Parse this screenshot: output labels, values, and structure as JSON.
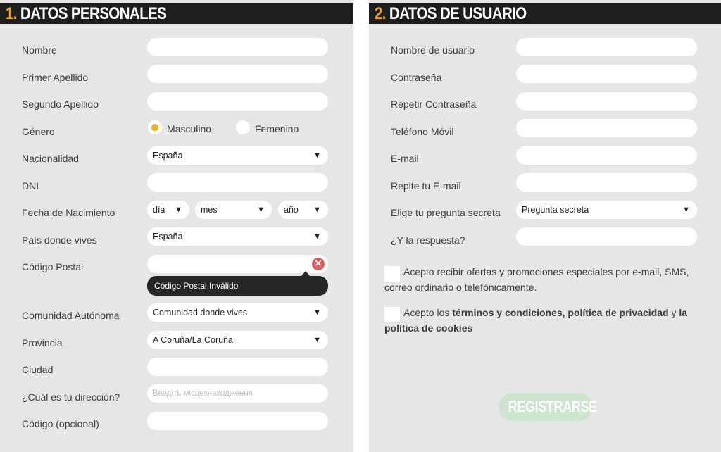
{
  "left": {
    "number": "1.",
    "title": "DATOS PERSONALES",
    "labels": {
      "nombre": "Nombre",
      "primer_apellido": "Primer Apellido",
      "segundo_apellido": "Segundo Apellido",
      "genero": "Género",
      "nacionalidad": "Nacionalidad",
      "dni": "DNI",
      "fecha_nacimiento": "Fecha de Nacimiento",
      "pais": "País donde vives",
      "codigo_postal": "Código Postal",
      "comunidad": "Comunidad Autónoma",
      "provincia": "Provincia",
      "ciudad": "Ciudad",
      "direccion": "¿Cuál es tu dirección?",
      "codigo_opcional": "Código (opcional)"
    },
    "gender_options": [
      "Masculino",
      "Femenino"
    ],
    "gender_selected": "Masculino",
    "nacionalidad_value": "España",
    "fecha": {
      "dia": "día",
      "mes": "mes",
      "ano": "año"
    },
    "pais_value": "España",
    "codigo_postal_error": "Código Postal Inválido",
    "error_icon": "close-x-icon",
    "comunidad_value": "Comunidad donde vives",
    "provincia_value": "A Coruña/La Coruña",
    "direccion_placeholder": "Введіть місцезнаходження"
  },
  "right": {
    "number": "2.",
    "title": "DATOS DE USUARIO",
    "labels": {
      "usuario": "Nombre de usuario",
      "contrasena": "Contraseña",
      "repetir_contrasena": "Repetir Contraseña",
      "telefono": "Teléfono Móvil",
      "email": "E-mail",
      "repite_email": "Repite tu E-mail",
      "pregunta": "Elige tu pregunta secreta",
      "respuesta": "¿Y la respuesta?"
    },
    "pregunta_value": "Pregunta secreta",
    "ofertas_text": "Acepto recibir ofertas y promociones especiales por e-mail, SMS, correo ordinario o telefónicamente.",
    "terms": {
      "t1": "Acepto los ",
      "t2": "términos y condiciones",
      "t3": ", ",
      "t4": "política de privacidad",
      "t5": " y ",
      "t6": "la política de cookies"
    },
    "register_label": "REGISTRARSE"
  },
  "colors": {
    "accent": "#f3a712",
    "header_bg": "#1e1e1e",
    "panel_bg": "#e6e6e6",
    "error": "#e25c5c",
    "register_disabled": "#cde4cf"
  },
  "caret_icon": "triangle-down-icon"
}
